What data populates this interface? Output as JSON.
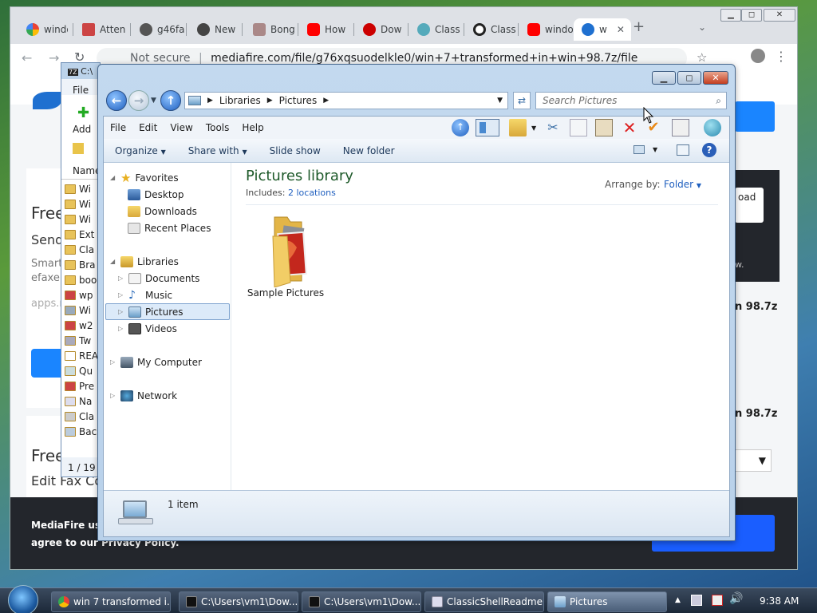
{
  "browser": {
    "tabs": [
      "windo",
      "Atten",
      "g46fa",
      "New",
      "Bong",
      "How",
      "Dow",
      "Class",
      "Class",
      "windo",
      "w"
    ],
    "url": "mediafire.com/file/g76xqsuodelkle0/win+7+transformed+in+win+98.7z/file",
    "security": "Not secure",
    "page_fragments": {
      "free1": "Free",
      "send": "Send",
      "smart": "Smart",
      "efax": "efaxe",
      "apps": "apps.m",
      "free2": "Free",
      "editfax": "Edit Fax Co",
      "right1": "n 98.7z",
      "right2": "n 98.7z",
      "load": "oad",
      "w": "w.",
      "cookie_line1": "MediaFire use",
      "cookie_line2": "agree to our Privacy Policy."
    }
  },
  "sevenzip": {
    "title": "C:\\",
    "menu_file": "File",
    "add_label": "Add",
    "col_name": "Name",
    "rows": [
      "Wi",
      "Wi",
      "Wi",
      "Ext",
      "Cla",
      "Bra",
      "boo",
      "wp",
      "Wi",
      "w2",
      "Tw",
      "REA",
      "Qu",
      "Pre",
      "Na",
      "Cla",
      "Bac"
    ],
    "status": "1 / 19 o"
  },
  "explorer": {
    "breadcrumb": [
      "Libraries",
      "Pictures"
    ],
    "search_placeholder": "Search Pictures",
    "menu": [
      "File",
      "Edit",
      "View",
      "Tools",
      "Help"
    ],
    "commands": [
      "Organize",
      "Share with",
      "Slide show",
      "New folder"
    ],
    "nav": {
      "favorites": "Favorites",
      "fav_items": [
        "Desktop",
        "Downloads",
        "Recent Places"
      ],
      "libraries": "Libraries",
      "lib_items": [
        "Documents",
        "Music",
        "Pictures",
        "Videos"
      ],
      "computer": "My Computer",
      "network": "Network"
    },
    "library_title": "Pictures library",
    "includes_label": "Includes:",
    "includes_link": "2 locations",
    "arrange_label": "Arrange by:",
    "arrange_value": "Folder",
    "items": [
      {
        "name": "Sample Pictures"
      }
    ],
    "item_count": "1 item"
  },
  "taskbar": {
    "tasks": [
      "win 7 transformed i...",
      "C:\\Users\\vm1\\Dow...",
      "C:\\Users\\vm1\\Dow...",
      "ClassicShellReadme...",
      "Pictures"
    ],
    "time": "9:38 AM"
  }
}
